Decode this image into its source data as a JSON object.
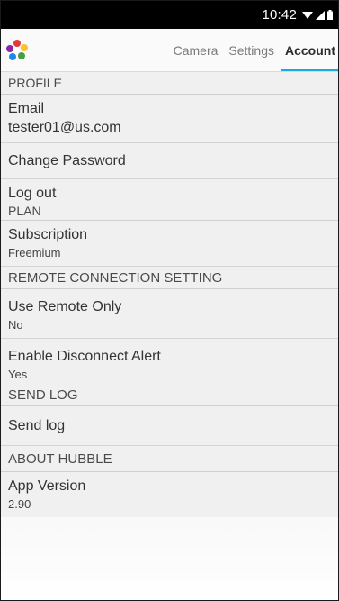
{
  "status_bar": {
    "time": "10:42"
  },
  "tabs": [
    {
      "label": "Camera"
    },
    {
      "label": "Settings"
    },
    {
      "label": "Account"
    }
  ],
  "profile": {
    "header": "PROFILE",
    "email_label": "Email",
    "email_value": "tester01@us.com",
    "change_password": "Change Password",
    "log_out": "Log out"
  },
  "plan": {
    "header": "PLAN",
    "subscription_label": "Subscription",
    "subscription_value": "Freemium"
  },
  "remote": {
    "header": "REMOTE CONNECTION SETTING",
    "use_remote_label": "Use Remote Only",
    "use_remote_value": "No",
    "disconnect_alert_label": "Enable Disconnect Alert",
    "disconnect_alert_value": "Yes"
  },
  "send_log": {
    "header": "SEND LOG",
    "item": "Send log"
  },
  "about": {
    "header": "ABOUT HUBBLE",
    "version_label": "App Version",
    "version_value": "2.90"
  },
  "colors": {
    "accent": "#1ea7e1",
    "status_bar": "#000000",
    "background": "#f0f0f0"
  },
  "icons": [
    "hubble-logo-icon",
    "wifi-icon",
    "signal-icon",
    "battery-icon"
  ]
}
